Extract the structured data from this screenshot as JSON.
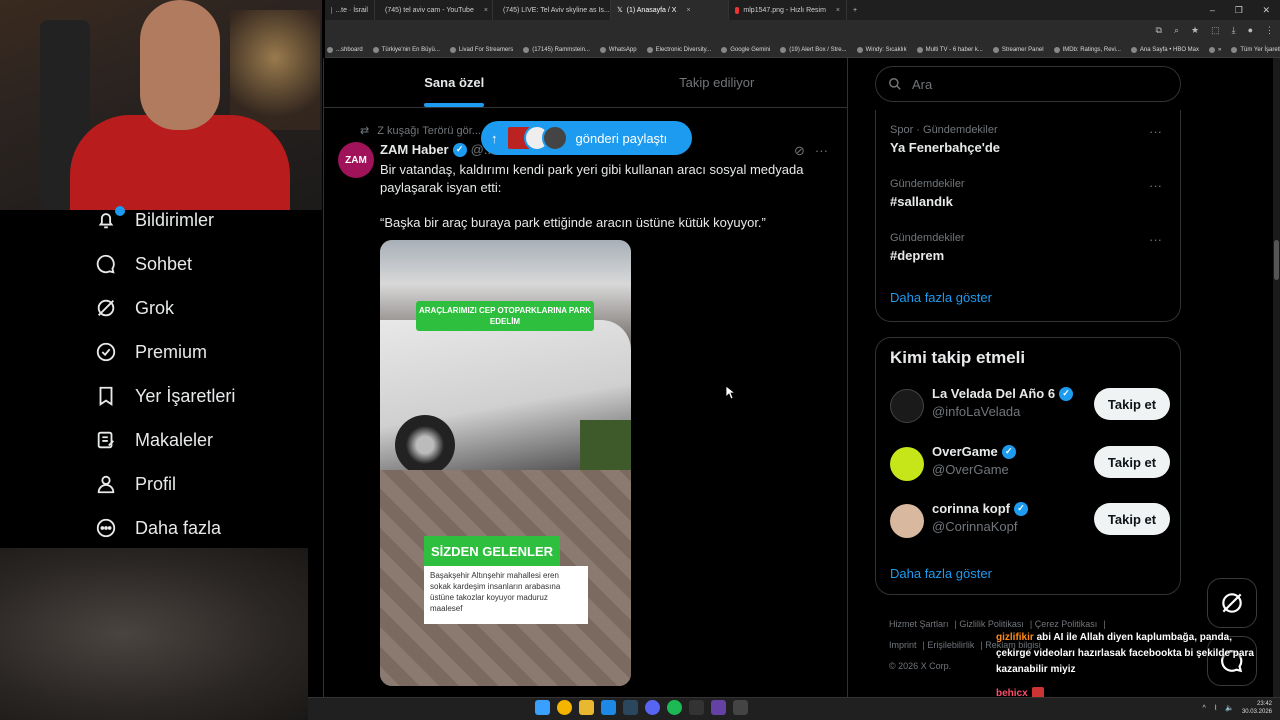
{
  "browser": {
    "tabs": [
      {
        "label": "...te · İsrail",
        "color": "#e0245e"
      },
      {
        "label": "(745) tel aviv cam - YouTube",
        "color": "#ff0000"
      },
      {
        "label": "(745) LIVE: Tel Aviv skyline as Is...",
        "color": "#ff0000"
      },
      {
        "label": "(1) Anasayfa / X",
        "color": "#ffffff",
        "active": true
      },
      {
        "label": "mlp1547.png - Hızlı Resim",
        "color": "#e0245e"
      }
    ],
    "new_tab": "+",
    "bookmarks": [
      "...shboard",
      "Türkiye'nin En Büyü...",
      "Livad For Streamers",
      "(17145) Rammstein...",
      "WhatsApp",
      "Electronic Diversity...",
      "Google Gemini",
      "(19) Alert Box / Stre...",
      "Windy: Sıcaklık",
      "Multi TV - 6 haber k...",
      "Streamer Panel",
      "IMDb: Ratings, Revi...",
      "Ana Sayfa • HBO Max",
      "»",
      "Tüm Yer İşaretleri"
    ]
  },
  "sidebar": {
    "items": [
      {
        "label": "Bildirimler",
        "icon": "bell-icon"
      },
      {
        "label": "Sohbet",
        "icon": "chat-icon"
      },
      {
        "label": "Grok",
        "icon": "grok-icon"
      },
      {
        "label": "Premium",
        "icon": "premium-icon"
      },
      {
        "label": "Yer İşaretleri",
        "icon": "bookmark-icon"
      },
      {
        "label": "Makaleler",
        "icon": "articles-icon"
      },
      {
        "label": "Profil",
        "icon": "profile-icon"
      },
      {
        "label": "Daha fazla",
        "icon": "more-icon"
      }
    ]
  },
  "feed": {
    "tabs": [
      "Sana özel",
      "Takip ediliyor"
    ],
    "repost_line": "Z kuşağı Terörü gör...",
    "share_pill": "gönderi paylaştı",
    "tweet": {
      "avatar_text": "ZAM",
      "author": "ZAM Haber",
      "handle": "@...",
      "text1": "Bir vatandaş, kaldırımı kendi park yeri gibi kullanan aracı sosyal medyada paylaşarak isyan etti:",
      "text2": "“Başka bir araç buraya park ettiğinde aracın üstüne kütük koyuyor.”",
      "media": {
        "banner": "ARAÇLARIMIZI CEP OTOPARKLARINA PARK EDELİM",
        "tag": "SİZDEN GELENLER",
        "card": "Başakşehir Altınşehir mahallesi eren sokak kardeşim insanların arabasına üstüne takozlar koyuyor maduruz maalesef"
      }
    }
  },
  "right": {
    "search_placeholder": "Ara",
    "trends": [
      {
        "category": "Spor · Gündemdekiler",
        "name": "Ya Fenerbahçe'de"
      },
      {
        "category": "Gündemdekiler",
        "name": "#sallandık"
      },
      {
        "category": "Gündemdekiler",
        "name": "#deprem"
      }
    ],
    "show_more": "Daha fazla göster",
    "who_to_follow": {
      "title": "Kimi takip etmeli",
      "accounts": [
        {
          "name": "La Velada Del Año 6",
          "handle": "@infoLaVelada",
          "button": "Takip et",
          "color": "#1a1a1a"
        },
        {
          "name": "OverGame",
          "handle": "@OverGame",
          "button": "Takip et",
          "color": "#c6e619"
        },
        {
          "name": "corinna kopf",
          "handle": "@CorinnaKopf",
          "button": "Takip et",
          "color": "#d9b8a0"
        }
      ],
      "show_more": "Daha fazla göster"
    },
    "footer": [
      "Hizmet Şartları",
      "Gizlilik Politikası",
      "Çerez Politikası",
      "Imprint",
      "Erişilebilirlik",
      "Reklam bilgisi",
      "© 2026 X Corp."
    ]
  },
  "chat_overlay": {
    "messages": [
      {
        "user": "gizlifikir",
        "text": "abi AI ile Allah diyen kaplumbağa, panda, çekirge videoları hazırlasak facebookta bi şekilde para kazanabilir miyiz"
      },
      {
        "user": "behicx",
        "text": ""
      },
      {
        "user": "behicx",
        "text": ""
      }
    ]
  },
  "taskbar": {
    "time": "23:42",
    "date": "30.03.2026"
  }
}
